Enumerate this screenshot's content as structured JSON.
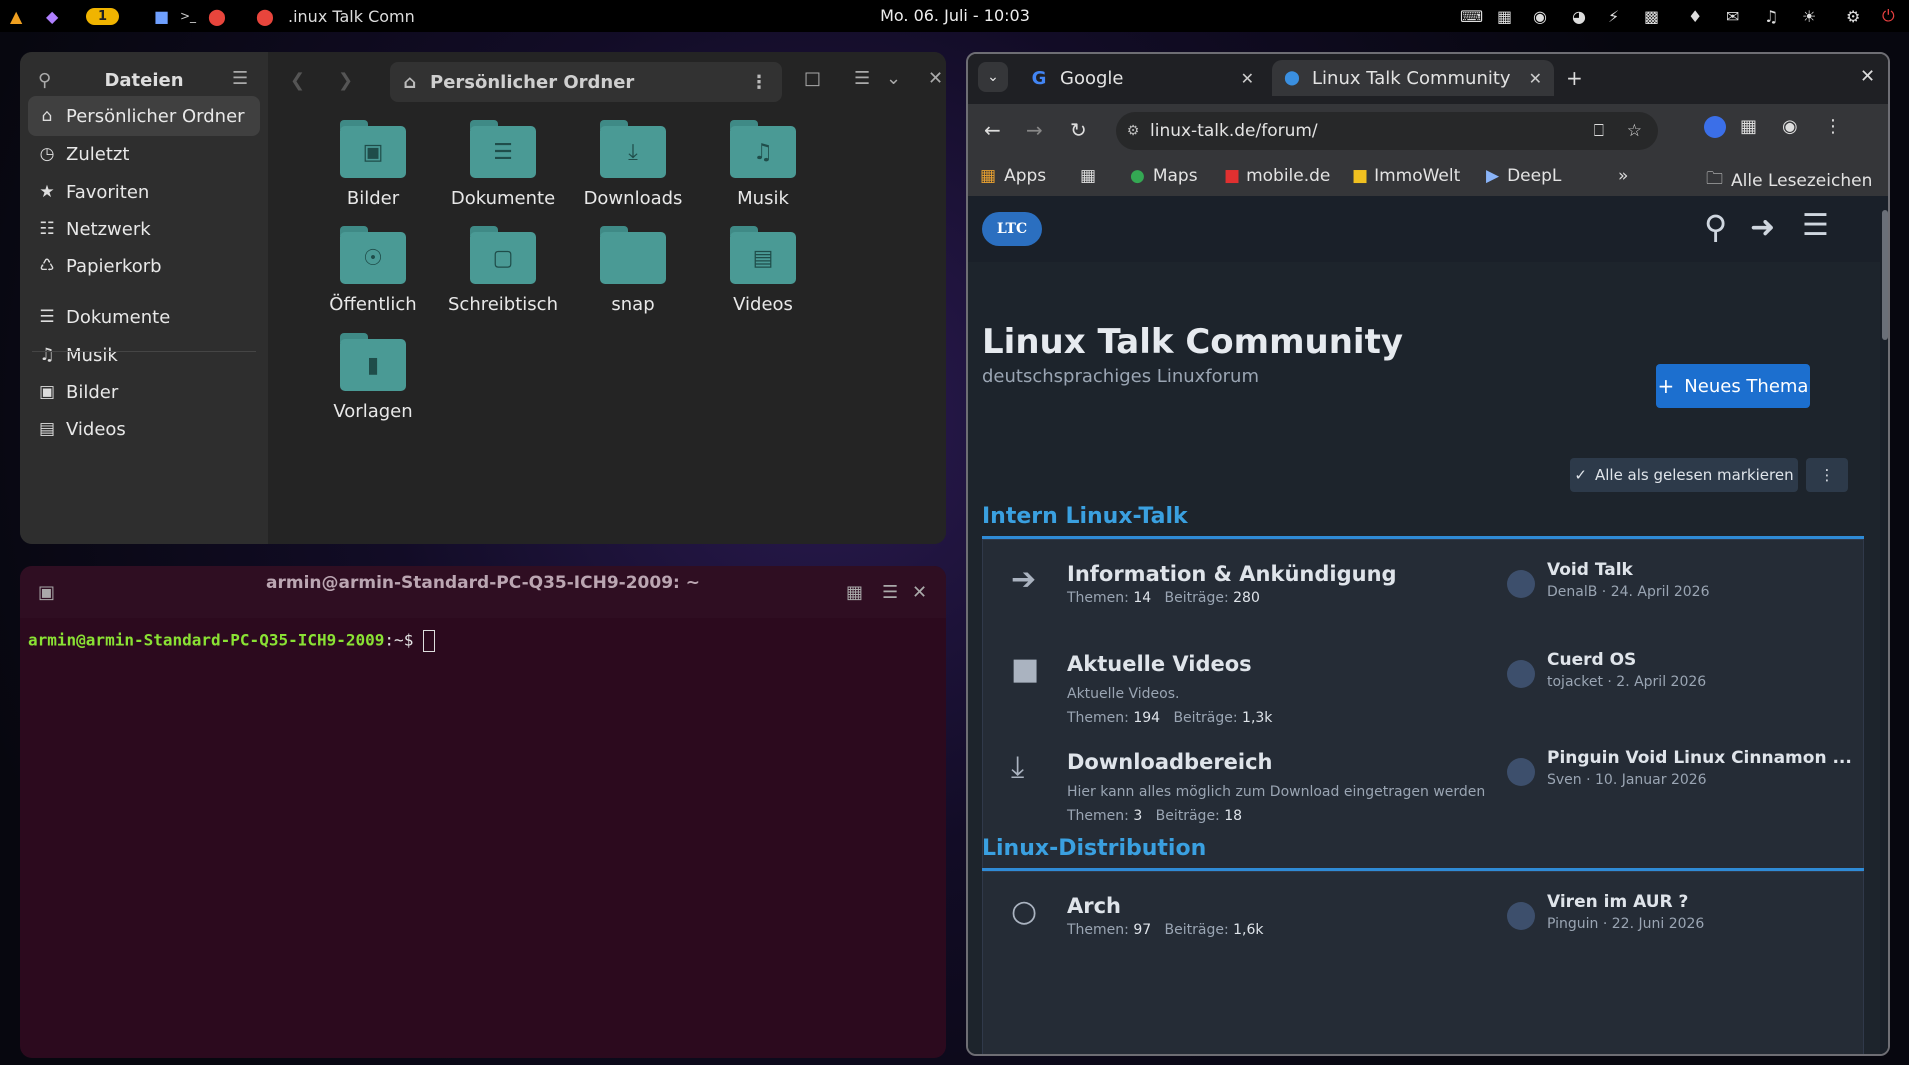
{
  "topbar": {
    "workspace_badge": "1",
    "active_app_title": ".inux Talk Comn",
    "clock": "Mo. 06. Juli - 10:03"
  },
  "files": {
    "app_title": "Dateien",
    "path": "Persönlicher Ordner",
    "sidebar": [
      {
        "label": "Persönlicher Ordner",
        "icon": "home-icon"
      },
      {
        "label": "Zuletzt",
        "icon": "clock-icon"
      },
      {
        "label": "Favoriten",
        "icon": "star-icon"
      },
      {
        "label": "Netzwerk",
        "icon": "network-icon"
      },
      {
        "label": "Papierkorb",
        "icon": "trash-icon"
      },
      {
        "label": "Dokumente",
        "icon": "document-icon"
      },
      {
        "label": "Musik",
        "icon": "music-icon"
      },
      {
        "label": "Bilder",
        "icon": "image-icon"
      },
      {
        "label": "Videos",
        "icon": "video-icon"
      }
    ],
    "folders": [
      {
        "label": "Bilder",
        "icon": "image-icon"
      },
      {
        "label": "Dokumente",
        "icon": "document-icon"
      },
      {
        "label": "Downloads",
        "icon": "download-icon"
      },
      {
        "label": "Musik",
        "icon": "music-icon"
      },
      {
        "label": "Öffentlich",
        "icon": "share-icon"
      },
      {
        "label": "Schreibtisch",
        "icon": "desktop-icon"
      },
      {
        "label": "snap",
        "icon": "folder-icon"
      },
      {
        "label": "Videos",
        "icon": "video-icon"
      },
      {
        "label": "Vorlagen",
        "icon": "template-icon"
      }
    ]
  },
  "terminal": {
    "title": "armin@armin-Standard-PC-Q35-ICH9-2009: ~",
    "prompt_user": "armin@armin-Standard-PC-Q35-ICH9-2009",
    "prompt_suffix": ":~$"
  },
  "browser": {
    "tabs": [
      {
        "label": "Google",
        "active": false
      },
      {
        "label": "Linux Talk Community",
        "active": true
      }
    ],
    "url": "linux-talk.de/forum/",
    "bookmarks": [
      "Apps",
      "Maps",
      "mobile.de",
      "ImmoWelt",
      "DeepL"
    ],
    "all_bookmarks": "Alle Lesezeichen"
  },
  "forum": {
    "logo_text": "LTC",
    "title": "Linux Talk Community",
    "subtitle": "deutschsprachiges Linuxforum",
    "new_thread": "Neues Thema",
    "mark_read": "Alle als gelesen markieren",
    "stat_labels": {
      "threads": "Themen:",
      "posts": "Beiträge:"
    },
    "categories": [
      {
        "title": "Intern Linux-Talk",
        "nodes": [
          {
            "title": "Information & Ankündigung",
            "desc": "",
            "threads": "14",
            "posts": "280",
            "last_title": "Void Talk",
            "last_meta": "DenalB · 24. April 2026",
            "icon": "megaphone-icon"
          },
          {
            "title": "Aktuelle Videos",
            "desc": "Aktuelle Videos.",
            "threads": "194",
            "posts": "1,3k",
            "last_title": "Cuerd OS",
            "last_meta": "tojacket · 2. April 2026",
            "icon": "video-camera-icon"
          },
          {
            "title": "Downloadbereich",
            "desc": "Hier kann alles möglich zum Download eingetragen werden",
            "threads": "3",
            "posts": "18",
            "last_title": "Pinguin Void Linux Cinnamon ...",
            "last_meta": "Sven · 10. Januar 2026",
            "icon": "download-icon"
          }
        ]
      },
      {
        "title": "Linux-Distribution",
        "nodes": [
          {
            "title": "Arch",
            "desc": "",
            "threads": "97",
            "posts": "1,6k",
            "last_title": "Viren im AUR ?",
            "last_meta": "Pinguin · 22. Juni 2026",
            "icon": "speech-bubble-icon"
          }
        ]
      }
    ]
  }
}
